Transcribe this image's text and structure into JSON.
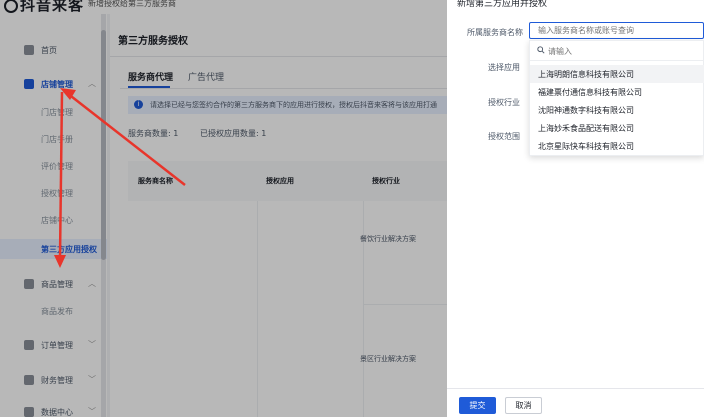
{
  "header": {
    "logo_text": "抖音来客",
    "system_title": "新增授权给第三方服务商"
  },
  "sidebar": {
    "home": "首页",
    "store_mgmt": "店铺管理",
    "store_sub": [
      "门店管理",
      "门店手册",
      "评价管理",
      "授权管理",
      "店铺中心",
      "第三方应用授权"
    ],
    "goods_mgmt": "商品管理",
    "goods_sub": [
      "商品发布"
    ],
    "order_mgmt": "订单管理",
    "finance_mgmt": "财务管理",
    "data_center": "数据中心"
  },
  "main": {
    "title": "第三方服务授权",
    "tabs": [
      "服务商代理",
      "广告代理"
    ],
    "notice": "请选择已经与您签约合作的第三方服务商下的应用进行授权，授权后抖音来客将与该应用打通",
    "stats": {
      "provider_count": "服务商数量: 1",
      "authorized_apps": "已授权应用数量: 1"
    },
    "table": {
      "headers": [
        "服务商名称",
        "授权应用",
        "授权行业"
      ],
      "rows": [
        "餐饮行业解决方案",
        "景区行业解决方案"
      ]
    }
  },
  "drawer": {
    "title": "新增第三方应用并授权",
    "labels": {
      "provider": "所属服务商名称",
      "app": "选择应用",
      "industry": "授权行业",
      "scope": "授权范围"
    },
    "provider_placeholder": "输入服务商名称或账号查询",
    "search_placeholder": "请输入",
    "options": [
      "上海明朗信息科技有限公司",
      "福建票付通信息科技有限公司",
      "沈阳神通数字科技有限公司",
      "上海妙禾食品配送有限公司",
      "北京星际快车科技有限公司"
    ],
    "submit": "提交",
    "cancel": "取消"
  },
  "colors": {
    "accent": "#1f5bd8",
    "arrow": "#e8352b"
  }
}
